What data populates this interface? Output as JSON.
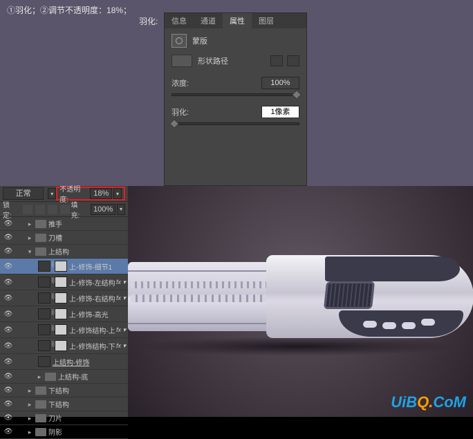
{
  "instruction": "①羽化；②调节不透明度：18%；",
  "feather_label": "羽化:",
  "panel": {
    "tabs": [
      "信息",
      "通道",
      "属性",
      "图层"
    ],
    "active_tab": 2,
    "mask_label": "蒙版",
    "shape_label": "形状路径",
    "density": {
      "label": "浓度:",
      "value": "100%"
    },
    "feather": {
      "label": "羽化:",
      "value": "1像素"
    }
  },
  "layers_panel": {
    "blend_mode": "正常",
    "opacity": {
      "label": "不透明度:",
      "value": "18%"
    },
    "lock_label": "锁定:",
    "fill": {
      "label": "填充:",
      "value": "100%"
    },
    "items": [
      {
        "type": "group",
        "name": "推手",
        "depth": 1,
        "open": false
      },
      {
        "type": "group",
        "name": "刀槽",
        "depth": 1,
        "open": false
      },
      {
        "type": "group",
        "name": "上结构",
        "depth": 1,
        "open": true
      },
      {
        "type": "layer",
        "name": "上-修饰-细节1",
        "depth": 2,
        "selected": true,
        "masked": true
      },
      {
        "type": "layer",
        "name": "上-修饰-左结构",
        "depth": 2,
        "fx": true,
        "masked": true
      },
      {
        "type": "layer",
        "name": "上-修饰-右结构",
        "depth": 2,
        "fx": true,
        "masked": true
      },
      {
        "type": "layer",
        "name": "上-修饰-高光",
        "depth": 2,
        "masked": true
      },
      {
        "type": "layer",
        "name": "上-修饰结构-上",
        "depth": 2,
        "fx": true,
        "masked": true
      },
      {
        "type": "layer",
        "name": "上-修饰结构-下",
        "depth": 2,
        "fx": true,
        "masked": true
      },
      {
        "type": "layer",
        "name": "上结构-修饰",
        "depth": 2,
        "underline": true,
        "masked": false
      },
      {
        "type": "group",
        "name": "上结构-底",
        "depth": 2,
        "open": false
      },
      {
        "type": "group",
        "name": "下结构",
        "depth": 1,
        "open": false
      },
      {
        "type": "group",
        "name": "下结构",
        "depth": 1,
        "open": false
      },
      {
        "type": "group",
        "name": "刀片",
        "depth": 1,
        "open": false
      },
      {
        "type": "group",
        "name": "阴影",
        "depth": 1,
        "open": false
      }
    ]
  },
  "watermark": {
    "a": "UiB",
    "b": "Q.",
    "c": "CoM"
  }
}
